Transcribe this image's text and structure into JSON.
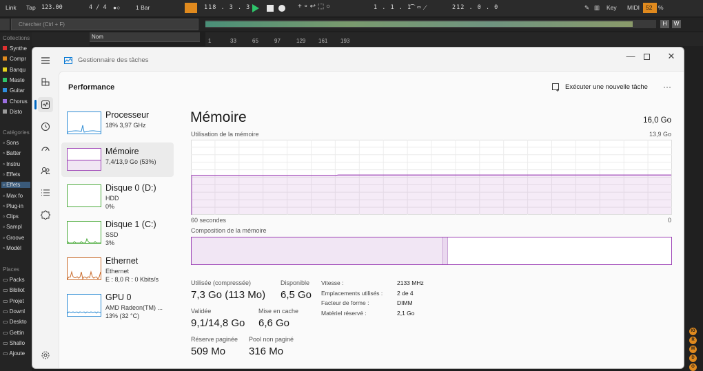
{
  "daw": {
    "link": "Link",
    "tap": "Tap",
    "tempo": "123.00",
    "sig": "4 / 4",
    "quant": "1 Bar",
    "position": "118 . 3 . 3",
    "loop_start": "1 . 1 . 1",
    "loop_len": "212 . 0 . 0",
    "key": "Key",
    "midi": "MIDI",
    "cpu": "52",
    "pct": "%",
    "search_placeholder": "Chercher (Ctrl + F)",
    "collections_header": "Collections",
    "name_col": "Nom",
    "collections": [
      {
        "label": "Synthe",
        "color": "#e03030"
      },
      {
        "label": "Compr",
        "color": "#e08a1e"
      },
      {
        "label": "Banqu",
        "color": "#e6d21e"
      },
      {
        "label": "Maste",
        "color": "#2ec46a"
      },
      {
        "label": "Guitar",
        "color": "#2f8ee0"
      },
      {
        "label": "Chorus",
        "color": "#9b6ee0"
      },
      {
        "label": "Disto",
        "color": "#9a9a9a"
      }
    ],
    "categories_header": "Catégories",
    "categories": [
      "Sons",
      "Batter",
      "Instru",
      "Effets",
      "Effets",
      "Max fo",
      "Plug-in",
      "Clips",
      "Sampl",
      "Groove",
      "Modèl"
    ],
    "places_header": "Places",
    "places": [
      "Packs",
      "Bibliot",
      "Projet",
      "Downl",
      "Deskto",
      "Gettin",
      "Shallo",
      "Ajoute"
    ],
    "ruler": [
      "1",
      "33",
      "65",
      "97",
      "129",
      "161",
      "193"
    ],
    "h_btn": "H",
    "w_btn": "W",
    "badges": [
      "IO",
      "R",
      "M",
      "D",
      "O"
    ]
  },
  "tm": {
    "app_title": "Gestionnaire des tâches",
    "page_title": "Performance",
    "run_task": "Exécuter une nouvelle tâche",
    "more": "···",
    "colors": {
      "memory": "#9b3fb5",
      "cpu": "#2a8ad4",
      "disk": "#4aaa3a",
      "ethernet": "#c96a2a",
      "gpu": "#2a8ad4"
    },
    "side": [
      {
        "title": "Processeur",
        "sub1": "18%  3,97 GHz",
        "sub2": ""
      },
      {
        "title": "Mémoire",
        "sub1": "7,4/13,9 Go (53%)",
        "sub2": ""
      },
      {
        "title": "Disque 0 (D:)",
        "sub1": "HDD",
        "sub2": "0%"
      },
      {
        "title": "Disque 1 (C:)",
        "sub1": "SSD",
        "sub2": "3%"
      },
      {
        "title": "Ethernet",
        "sub1": "Ethernet",
        "sub2": "E : 8,0  R : 0 Kbits/s"
      },
      {
        "title": "GPU 0",
        "sub1": "AMD Radeon(TM) ...",
        "sub2": "13%  (32 °C)"
      }
    ],
    "main": {
      "title": "Mémoire",
      "capacity": "16,0 Go",
      "usage_label": "Utilisation de la mémoire",
      "usage_max": "13,9 Go",
      "time_label": "60 secondes",
      "zero": "0",
      "composition_label": "Composition de la mémoire",
      "usage_fraction": 0.53,
      "composition_in_use_fraction": 0.525,
      "composition_modified_fraction": 0.01,
      "stats": {
        "used_label": "Utilisée (compressée)",
        "used_value": "7,3 Go (113 Mo)",
        "available_label": "Disponible",
        "available_value": "6,5 Go",
        "committed_label": "Validée",
        "committed_value": "9,1/14,8 Go",
        "cached_label": "Mise en cache",
        "cached_value": "6,6 Go",
        "paged_label": "Réserve paginée",
        "paged_value": "509 Mo",
        "nonpaged_label": "Pool non paginé",
        "nonpaged_value": "316 Mo"
      },
      "details": [
        {
          "k": "Vitesse :",
          "v": "2133 MHz"
        },
        {
          "k": "Emplacements utilisés :",
          "v": "2 de 4"
        },
        {
          "k": "Facteur de forme :",
          "v": "DIMM"
        },
        {
          "k": "Matériel réservé :",
          "v": "2,1 Go"
        }
      ]
    }
  }
}
